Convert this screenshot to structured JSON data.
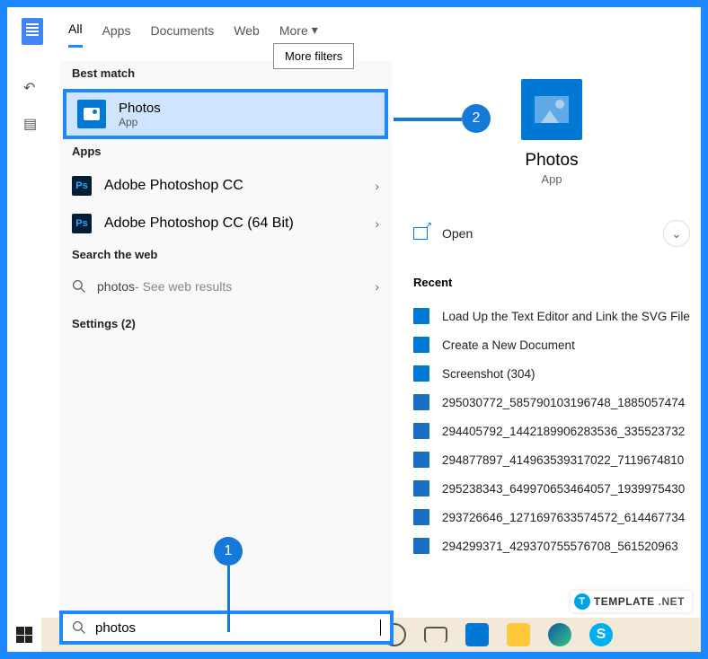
{
  "tabs": {
    "all": "All",
    "apps": "Apps",
    "documents": "Documents",
    "web": "Web",
    "more": "More"
  },
  "tooltip": "More filters",
  "left": {
    "best_match_label": "Best match",
    "best_match": {
      "title": "Photos",
      "sub": "App"
    },
    "apps_label": "Apps",
    "apps": [
      {
        "name": "Adobe Photoshop CC"
      },
      {
        "name": "Adobe Photoshop CC (64 Bit)"
      }
    ],
    "web_label": "Search the web",
    "web_query": "photos",
    "web_sub": " - See web results",
    "settings_label": "Settings (2)"
  },
  "right": {
    "title": "Photos",
    "sub": "App",
    "open": "Open",
    "recent_label": "Recent",
    "recent": [
      "Load Up the Text Editor and Link the SVG File",
      "Create a New Document",
      "Screenshot (304)",
      "295030772_585790103196748_1885057474",
      "294405792_1442189906283536_335523732",
      "294877897_414963539317022_7119674810",
      "295238343_649970653464057_1939975430",
      "293726646_1271697633574572_614467734",
      "294299371_429370755576708_561520963"
    ]
  },
  "search": {
    "query": "photos"
  },
  "callouts": {
    "one": "1",
    "two": "2"
  },
  "watermark": {
    "badge": "T",
    "text1": "TEMPLATE",
    "text2": ".NET"
  }
}
